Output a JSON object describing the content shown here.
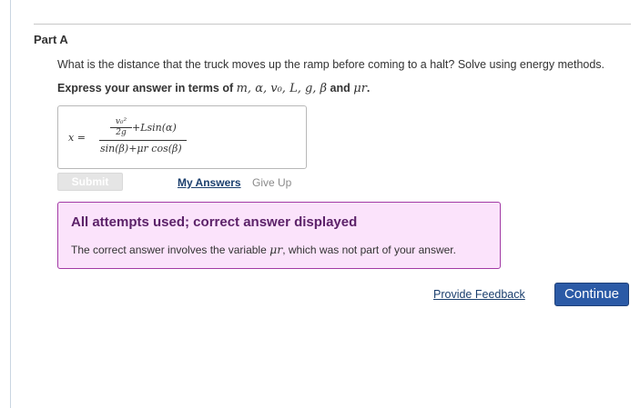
{
  "part": {
    "title": "Part A"
  },
  "question": {
    "text": "What is the distance that the truck moves up the ramp before coming to a halt? Solve using energy methods."
  },
  "instruction": {
    "prefix": "Express your answer in terms of ",
    "variables": "m, α, v₀, L, g, β",
    "conjunction": " and ",
    "last_variable": "μr",
    "suffix": "."
  },
  "answer": {
    "variable": "x =",
    "inner_numerator": "v₀²",
    "inner_denominator": "2g",
    "numerator_tail": "+Lsin(α)",
    "denominator": "sin(β)+μr cos(β)"
  },
  "actions": {
    "submit_label": "Submit",
    "my_answers_label": "My Answers",
    "give_up_label": "Give Up"
  },
  "feedback": {
    "title": "All attempts used; correct answer displayed",
    "text_before": "The correct answer involves the variable ",
    "variable": "μr",
    "text_after": ", which was not part of your answer."
  },
  "footer": {
    "provide_feedback_label": "Provide Feedback",
    "continue_label": "Continue"
  },
  "colors": {
    "feedback_bg": "#fbe3fb",
    "feedback_border": "#a23aa5",
    "feedback_title": "#5c2269",
    "continue_bg": "#2b5aa6",
    "link": "#1b3f6e"
  }
}
